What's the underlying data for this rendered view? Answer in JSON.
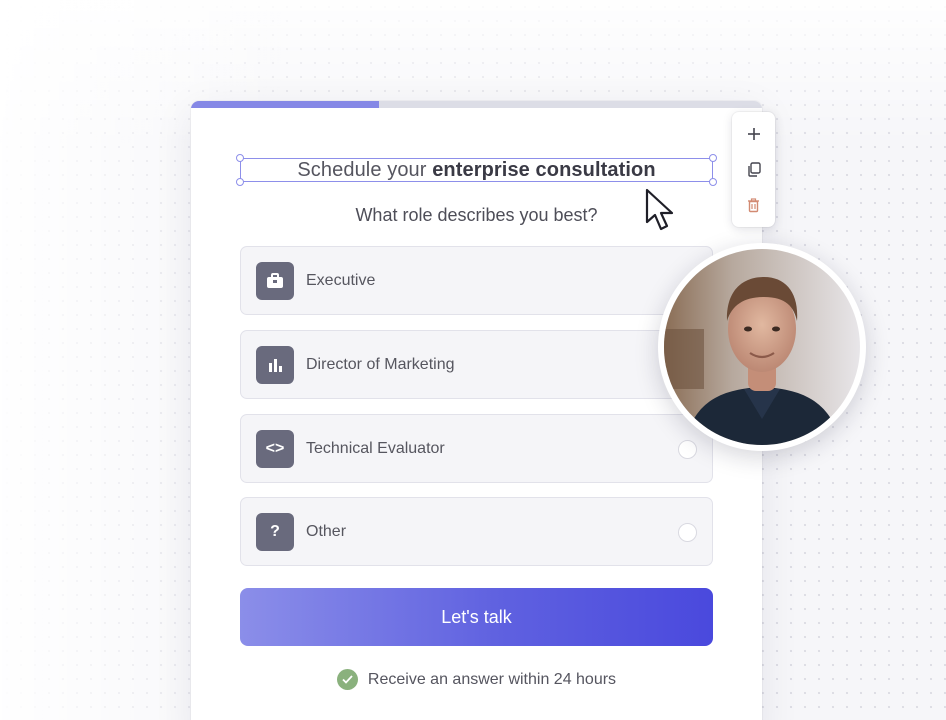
{
  "form": {
    "progress_percent": 33,
    "title_prefix": "Schedule your ",
    "title_bold": "enterprise consultation",
    "question": "What role describes you best?",
    "options": [
      {
        "label": "Executive",
        "icon": "briefcase-icon"
      },
      {
        "label": "Director of Marketing",
        "icon": "bar-chart-icon"
      },
      {
        "label": "Technical Evaluator",
        "icon": "code-icon",
        "glyph": "<>"
      },
      {
        "label": "Other",
        "icon": "question-icon",
        "glyph": "?"
      }
    ],
    "cta_label": "Let's talk",
    "note": "Receive an answer within 24 hours"
  },
  "toolbar": {
    "items": [
      "add-icon",
      "duplicate-icon",
      "delete-icon"
    ]
  },
  "colors": {
    "accent": "#5f61e0",
    "selection": "#8d8fea",
    "icon_bg": "#696a7d",
    "success": "#8ab17d",
    "delete": "#d28a72"
  }
}
